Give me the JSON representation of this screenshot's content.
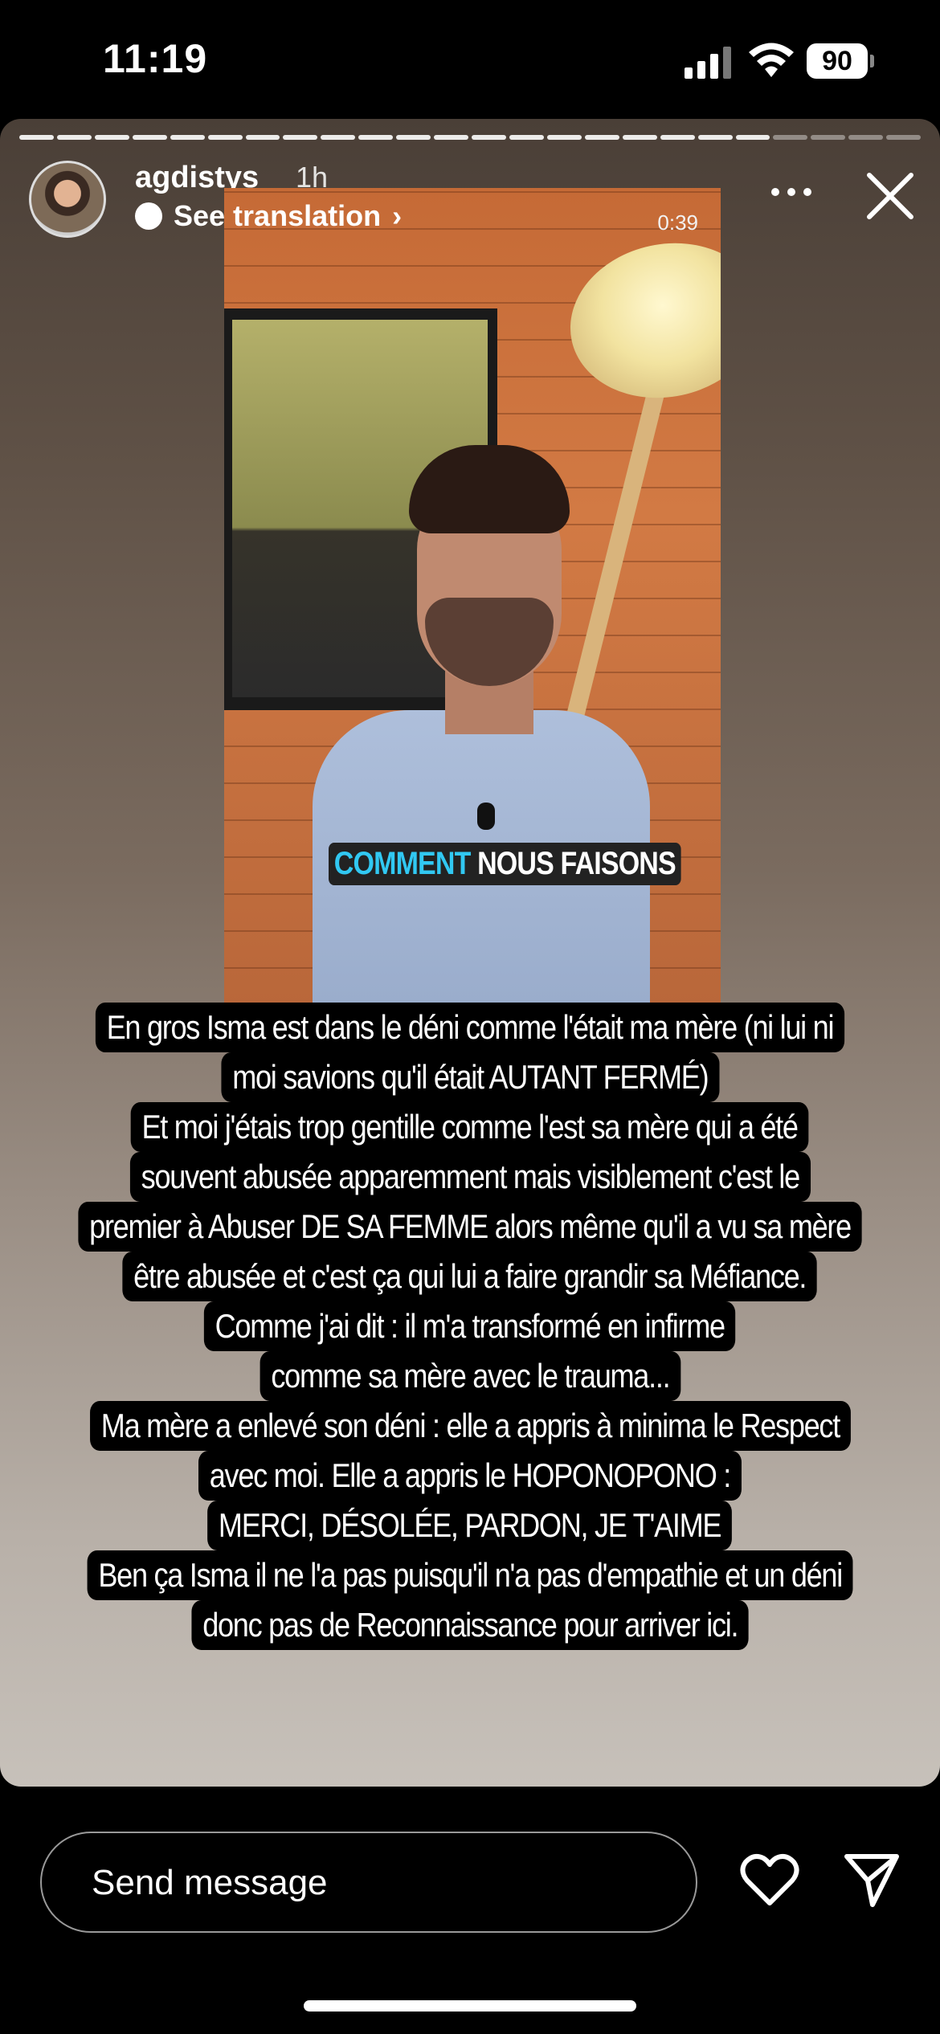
{
  "status_bar": {
    "time": "11:19",
    "battery": "90"
  },
  "story": {
    "username": "agdistys",
    "timestamp": "1h",
    "translation_label": "See translation",
    "progress_segments_total": 24,
    "progress_segments_viewed": 20,
    "video": {
      "duration": "0:39",
      "caption_highlight": "COMMENT",
      "caption_rest": "NOUS FAISONS"
    },
    "overlay_lines": [
      "En gros Isma est dans le déni comme l'était ma mère (ni lui ni",
      "moi savions qu'il était AUTANT FERMÉ)",
      "Et moi j'étais trop gentille comme l'est sa mère qui a été",
      "souvent  abusée apparemment mais visiblement c'est le",
      "premier à Abuser DE SA FEMME alors même qu'il a vu sa mère",
      "être abusée et c'est ça qui lui a faire grandir sa Méfiance.",
      "Comme j'ai dit : il m'a transformé en infirme",
      "comme sa mère avec le trauma...",
      "Ma mère a enlevé son déni : elle a appris à minima le Respect",
      "avec moi. Elle a appris le HOPONOPONO :",
      "MERCI, DÉSOLÉE, PARDON, JE T'AIME",
      "Ben ça Isma il ne l'a pas puisqu'il n'a pas d'empathie et un déni",
      "donc pas de Reconnaissance pour arriver ici."
    ]
  },
  "bottom_bar": {
    "message_placeholder": "Send message"
  },
  "icons": {
    "signal": "signal-icon",
    "wifi": "wifi-icon",
    "more": "more-icon",
    "close": "close-icon",
    "heart": "heart-icon",
    "send": "send-icon",
    "translate": "translate-bubble-icon"
  },
  "colors": {
    "caption_accent": "#31c8f2",
    "background": "#000000"
  }
}
